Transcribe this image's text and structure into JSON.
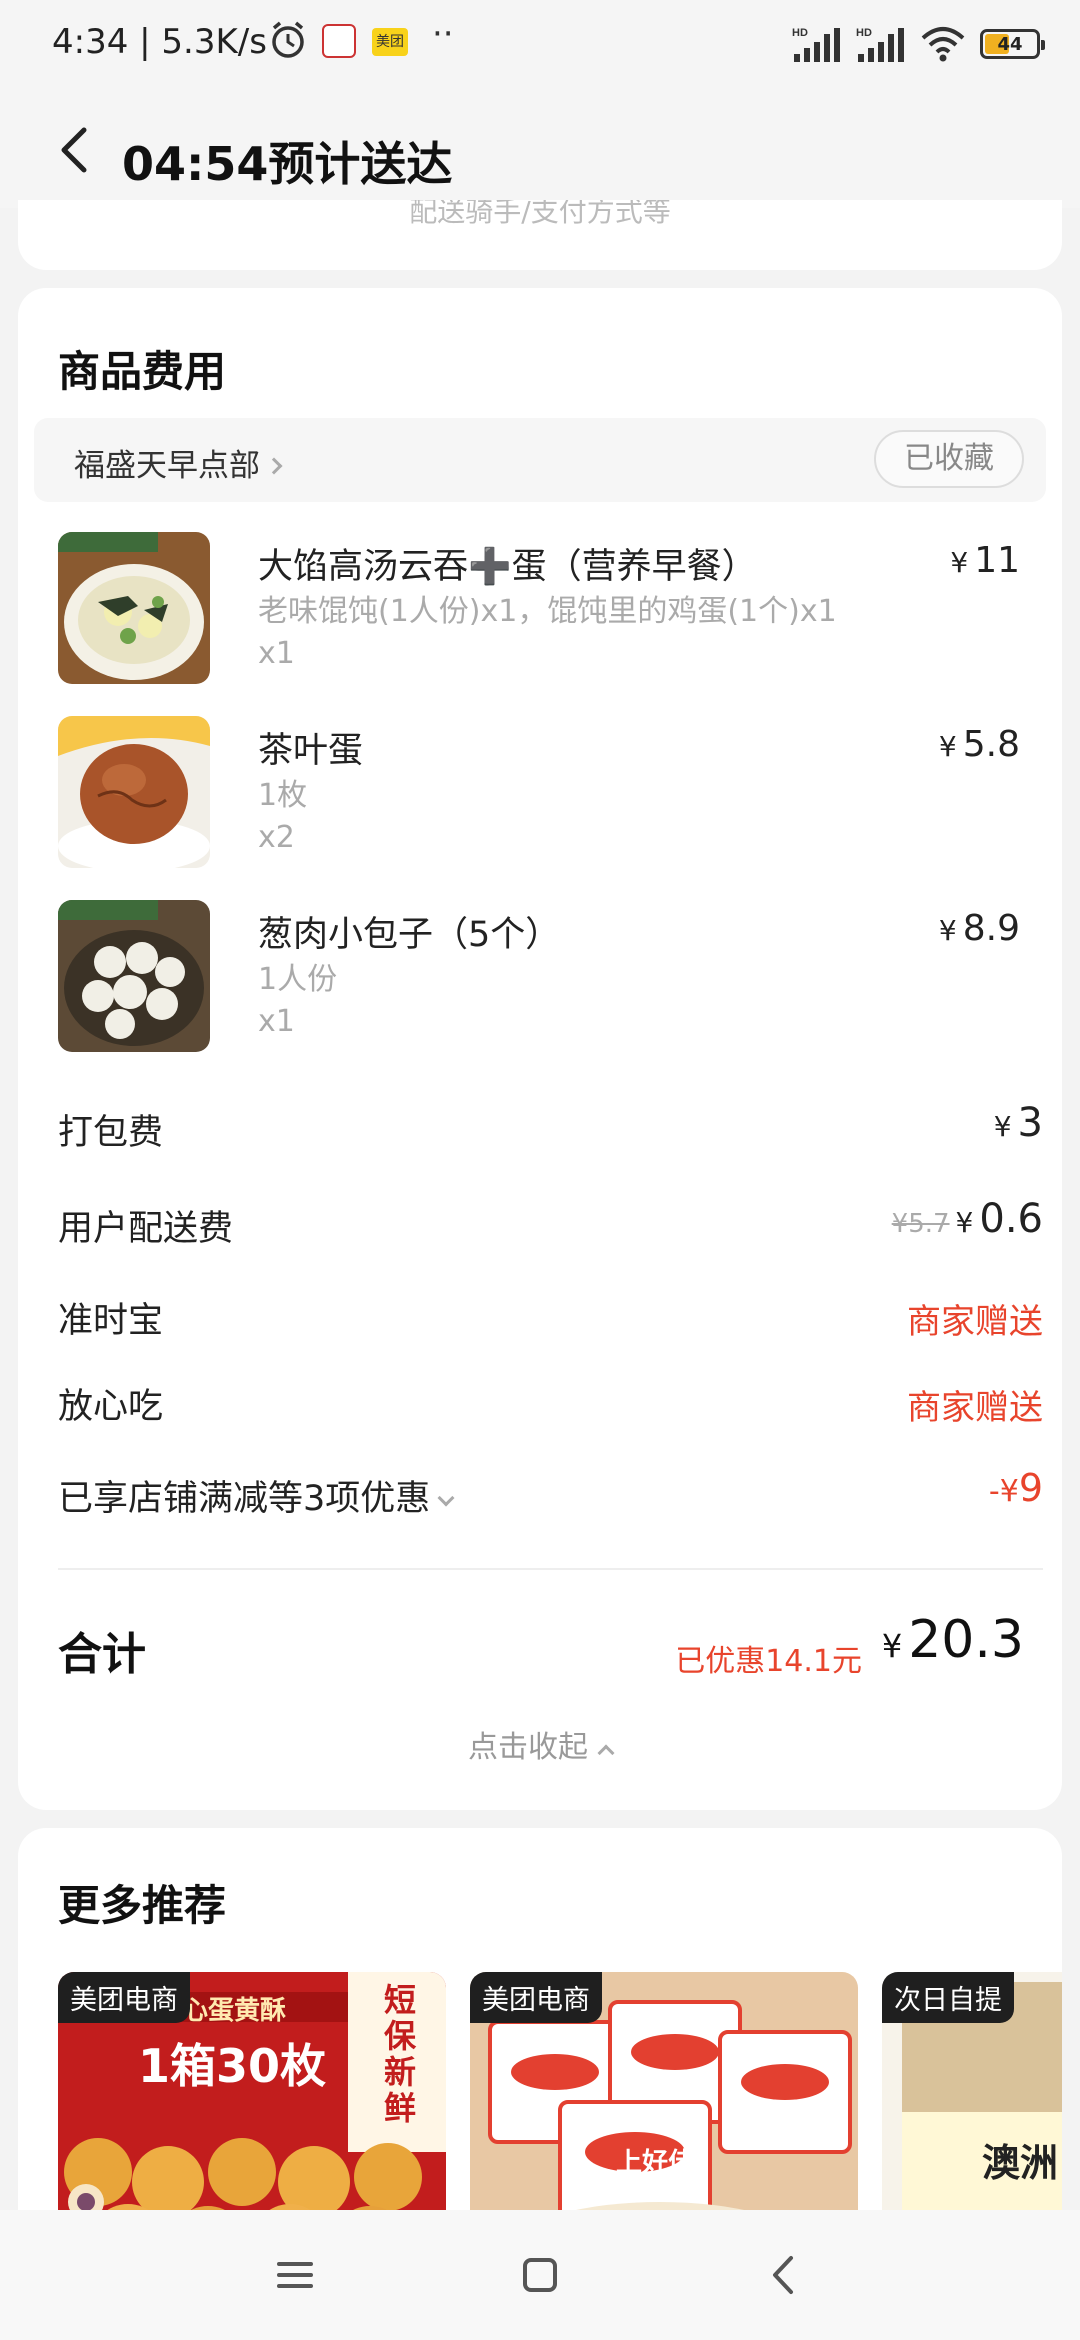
{
  "status_bar": {
    "time": "4:34 | 5.3K/s",
    "app2_label": "美团",
    "battery": "44"
  },
  "header": {
    "title": "04:54预计送达"
  },
  "top_card": {
    "text": "配送骑手/支付方式等"
  },
  "order": {
    "section_title": "商品费用",
    "shop_name": "福盛天早点部",
    "shop_fav_label": "已收藏",
    "items": [
      {
        "name": "大馅高汤云吞➕蛋（营养早餐）",
        "spec": "老味馄饨(1人份)x1，馄饨里的鸡蛋(1个)x1",
        "qty": "x1",
        "currency": "¥",
        "price": "11"
      },
      {
        "name": "茶叶蛋",
        "spec": "1枚",
        "qty": "x2",
        "currency": "¥",
        "price": "5.8"
      },
      {
        "name": "葱肉小包子（5个）",
        "spec": "1人份",
        "qty": "x1",
        "currency": "¥",
        "price": "8.9"
      }
    ],
    "fees": {
      "packing_label": "打包费",
      "packing_currency": "¥",
      "packing_value": "3",
      "delivery_label": "用户配送费",
      "delivery_original": "¥5.7",
      "delivery_currency": "¥",
      "delivery_value": "0.6",
      "ontime_label": "准时宝",
      "ontime_value": "商家赠送",
      "safe_label": "放心吃",
      "safe_value": "商家赠送",
      "discount_label": "已享店铺满减等3项优惠",
      "discount_prefix": "-¥",
      "discount_value": "9"
    },
    "total_label": "合计",
    "total_saved": "已优惠14.1元",
    "total_currency": "¥",
    "total_value": "20.3",
    "collapse_label": "点击收起"
  },
  "recommend": {
    "title": "更多推荐",
    "items": [
      {
        "tag": "美团电商",
        "banner": "1箱30枚",
        "sub": "雪媚娘夹心蛋黄酥",
        "side": "短保新鲜"
      },
      {
        "tag": "美团电商",
        "banner": "上好佳"
      },
      {
        "tag": "次日自提",
        "banner": "澳洲"
      }
    ]
  },
  "colors": {
    "accent_red": "#e8442c",
    "background": "#f3f3f3"
  }
}
